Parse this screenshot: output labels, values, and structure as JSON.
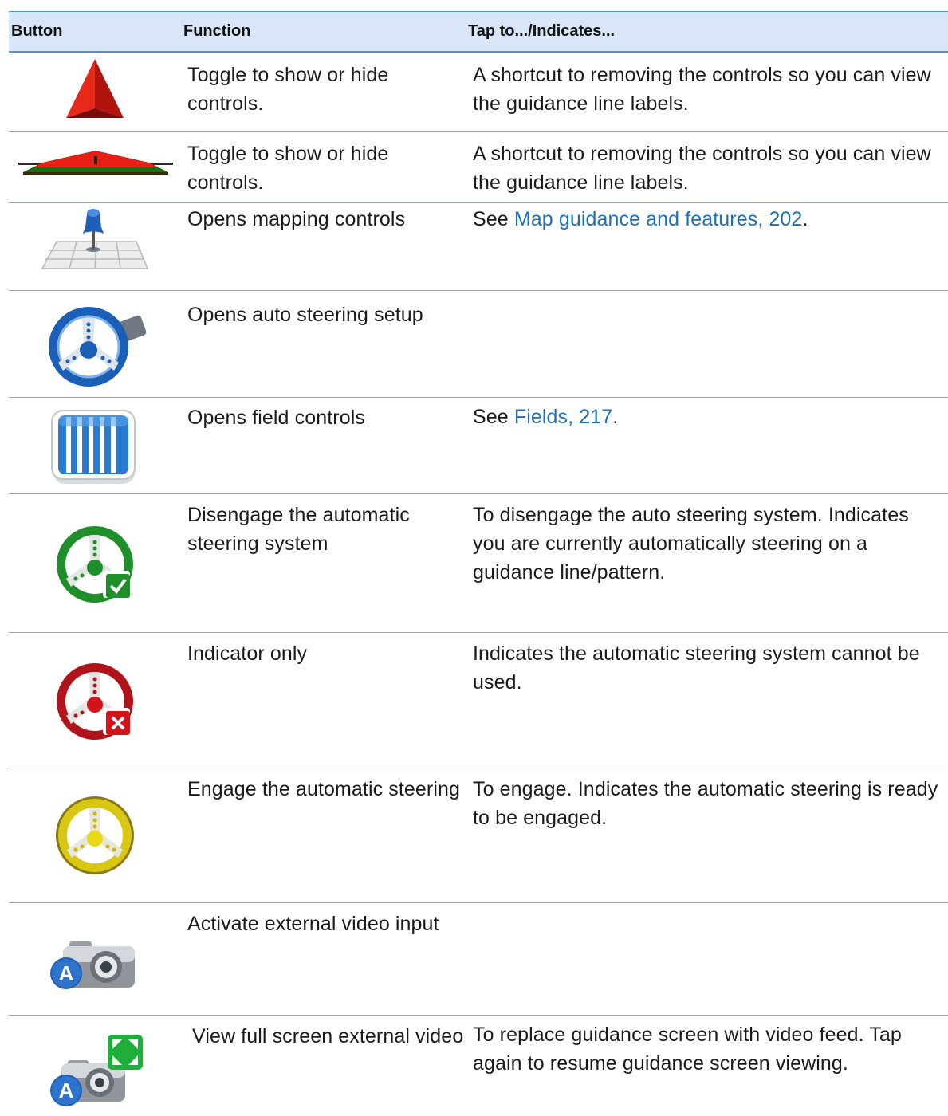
{
  "table": {
    "headers": {
      "button": "Button",
      "function": "Function",
      "tap": "Tap to.../Indicates..."
    },
    "rows": [
      {
        "icon": "red-pyramid-icon",
        "function": "Toggle to show or hide controls.",
        "tap_text": "A shortcut to removing the controls so you can view the guidance line labels."
      },
      {
        "icon": "red-flat-pyramid-icon",
        "function": "Toggle to show or hide controls.",
        "tap_text": "A shortcut to removing the controls so you can view the guidance line labels."
      },
      {
        "icon": "map-pin-grid-icon",
        "function": "Opens mapping controls",
        "tap_prefix": "See ",
        "tap_link": "Map guidance and features, 202",
        "tap_suffix": "."
      },
      {
        "icon": "blue-steering-wheel-icon",
        "function": "Opens auto steering setup",
        "tap_text": ""
      },
      {
        "icon": "field-bars-icon",
        "function": "Opens field controls",
        "tap_prefix": "See ",
        "tap_link": "Fields, 217",
        "tap_suffix": "."
      },
      {
        "icon": "green-steering-wheel-check-icon",
        "function": "Disengage the automatic steering system",
        "tap_text": "To disengage the auto steering system. Indicates you are currently automatically steering on a guidance line/pattern."
      },
      {
        "icon": "red-steering-wheel-x-icon",
        "function": "Indicator only",
        "tap_text": "Indicates the automatic steering system cannot be used."
      },
      {
        "icon": "yellow-steering-wheel-icon",
        "function": "Engage the automatic steering",
        "tap_text": "To engage. Indicates the automatic steering is ready to be engaged."
      },
      {
        "icon": "camera-a-icon",
        "function": "Activate external video input",
        "tap_text": ""
      },
      {
        "icon": "camera-fullscreen-icon",
        "function": "View full screen external video",
        "tap_text": "To replace guidance screen with video feed. Tap again to resume guidance screen viewing."
      }
    ]
  },
  "colors": {
    "header_bg": "#d9e6f7",
    "header_border": "#5a8fc7",
    "link": "#1f6fb5",
    "row_border": "#9ea7b1"
  }
}
